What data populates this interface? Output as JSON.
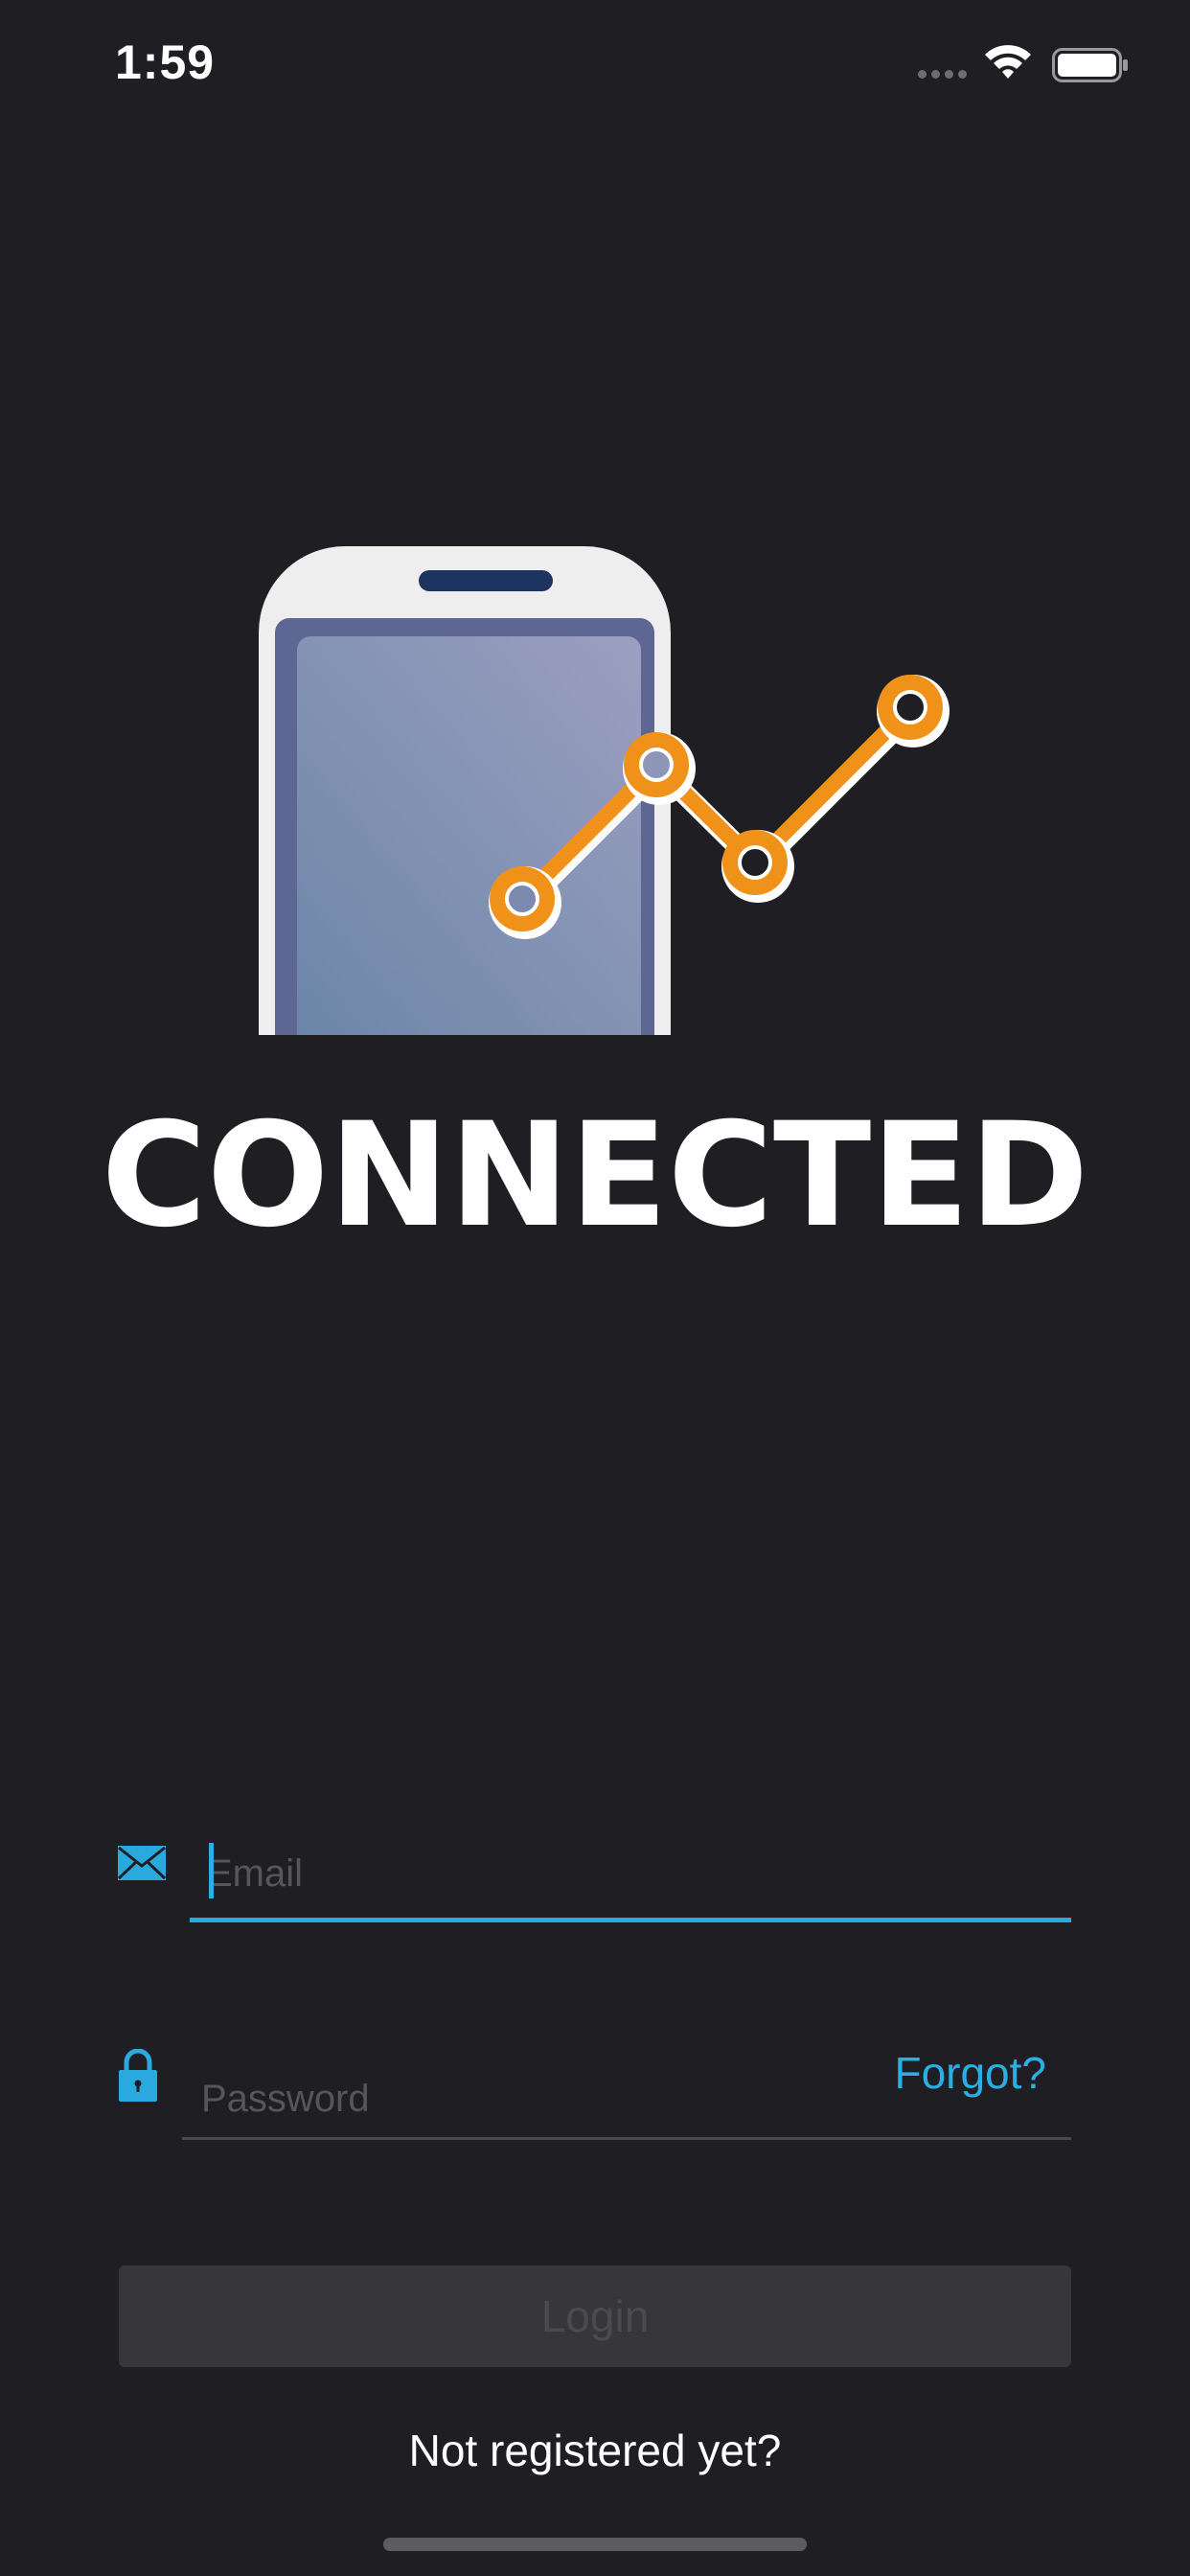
{
  "status_bar": {
    "time": "1:59",
    "icons": [
      "cellular-signal-icon",
      "wifi-icon",
      "battery-icon"
    ]
  },
  "hero": {
    "icon": "phone-with-line-chart-illustration",
    "title": "CONNECTED"
  },
  "form": {
    "email": {
      "icon": "envelope-icon",
      "placeholder": "Email",
      "value": ""
    },
    "password": {
      "icon": "lock-icon",
      "placeholder": "Password",
      "value": "",
      "forgot_label": "Forgot?"
    },
    "login_label": "Login",
    "register_label": "Not registered yet?"
  },
  "colors": {
    "background": "#1f1e23",
    "accent": "#2aaee3",
    "chart_orange": "#f0921a",
    "button_disabled": "#37363b"
  }
}
